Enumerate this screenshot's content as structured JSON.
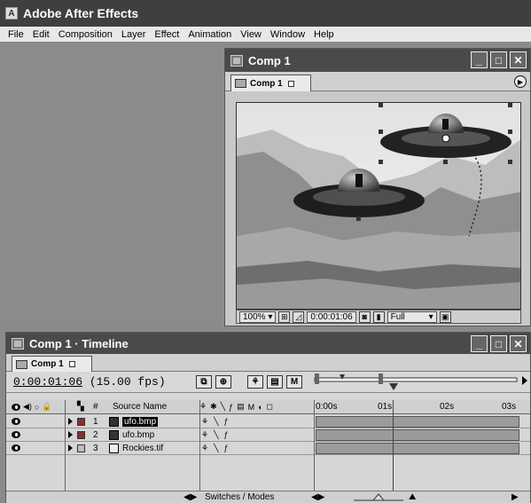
{
  "app": {
    "title": "Adobe After Effects",
    "logo_glyph": "A"
  },
  "menu": [
    "File",
    "Edit",
    "Composition",
    "Layer",
    "Effect",
    "Animation",
    "View",
    "Window",
    "Help"
  ],
  "comp_window": {
    "title": "Comp 1",
    "tab_label": "Comp 1",
    "buttons": {
      "minimize": "_",
      "maximize": "□",
      "close": "✕"
    },
    "status": {
      "zoom": "100%",
      "timecode": "0:00:01:06",
      "resolution": "Full"
    }
  },
  "timeline_window": {
    "title": "Comp 1 · Timeline",
    "tab_label": "Comp 1",
    "timecode": "0:00:01:06",
    "fps": "(15.00 fps)",
    "tools": [
      "⧉",
      "⊕",
      "⚘",
      "▤",
      "M"
    ],
    "headers": {
      "hash": "#",
      "source_name": "Source Name"
    },
    "ruler": [
      "0:00s",
      "01s",
      "02s",
      "03s"
    ],
    "switches_label": "Switches / Modes",
    "layers": [
      {
        "number": "1",
        "name": "ufo.bmp",
        "selected": true,
        "color": "#8a2e2e"
      },
      {
        "number": "2",
        "name": "ufo.bmp",
        "selected": false,
        "color": "#8a2e2e"
      },
      {
        "number": "3",
        "name": "Rockies.tif",
        "selected": false,
        "color": "#bdbdbd"
      }
    ]
  },
  "colors": {
    "titlebar": "#4a4a4a",
    "workspace": "#8b8b8b",
    "layer_bar": "#9b9b9b"
  }
}
